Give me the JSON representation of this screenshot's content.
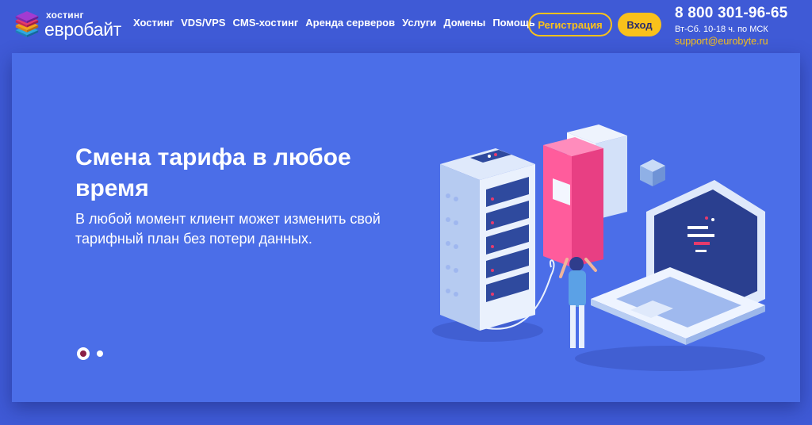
{
  "logo": {
    "small": "хостинг",
    "big": "евробайт"
  },
  "nav": [
    {
      "label": "Хостинг"
    },
    {
      "label": "VDS/VPS"
    },
    {
      "label": "CMS-хостинг"
    },
    {
      "label": "Аренда серверов"
    },
    {
      "label": "Услуги"
    },
    {
      "label": "Домены"
    },
    {
      "label": "Помощь"
    }
  ],
  "auth": {
    "register_label": "Регистрация",
    "login_label": "Вход"
  },
  "contacts": {
    "phone": "8 800 301-96-65",
    "hours": "Вт-Сб. 10-18 ч. по МСК",
    "email": "support@eurobyte.ru"
  },
  "hero": {
    "title": "Смена тарифа в любое время",
    "text": "В любой момент клиент может изменить свой тарифный план без потери данных."
  },
  "slider": {
    "active_index": 0,
    "count": 2
  },
  "colors": {
    "page_bg": "#3f5ad6",
    "hero_bg": "#4b6ee8",
    "accent": "#f9c11b",
    "dot_active_center": "#8a1f47"
  },
  "icons": {
    "logo": "stacked-cubes-icon",
    "illustration": "server-laptop-illustration"
  }
}
